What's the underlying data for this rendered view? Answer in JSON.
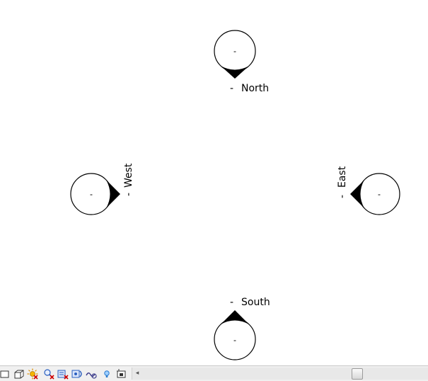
{
  "view": {
    "markers": [
      {
        "name": "north",
        "label": "North",
        "value": "-",
        "leader": "-"
      },
      {
        "name": "west",
        "label": "West",
        "value": "-",
        "leader": "-"
      },
      {
        "name": "east",
        "label": "East",
        "value": "-",
        "leader": "-"
      },
      {
        "name": "south",
        "label": "South",
        "value": "-",
        "leader": "-"
      }
    ]
  },
  "statusbar": {
    "icons": [
      "2d-box-icon",
      "3d-box-icon",
      "sun-path-icon",
      "remove-hidden-icon",
      "reveal-hidden-icon",
      "temporary-hide-icon",
      "analysis-display-icon",
      "lightbulb-icon",
      "crop-view-icon"
    ],
    "scroll_left_glyph": "◂"
  }
}
